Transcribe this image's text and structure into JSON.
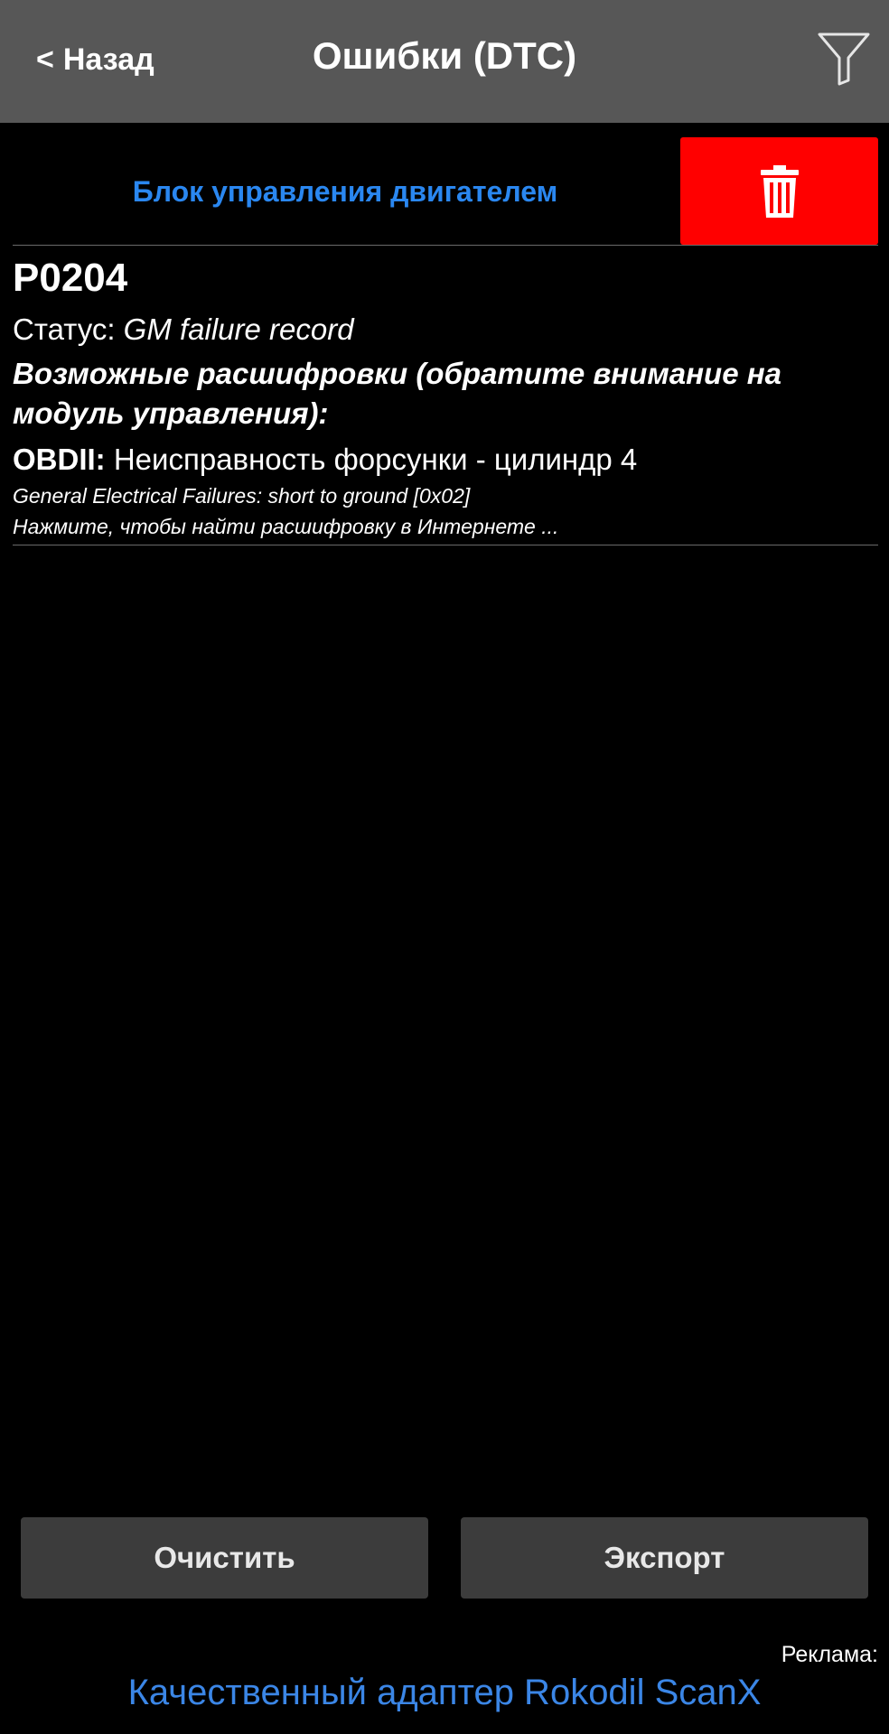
{
  "appbar": {
    "back_label": "Назад",
    "back_chevron": "<",
    "title": "Ошибки (DTC)",
    "filter_icon": "filter-funnel-icon"
  },
  "module": {
    "name": "Блок управления двигателем",
    "delete_icon": "trash-icon",
    "delete_color": "#ff0000",
    "name_color": "#2a87f0"
  },
  "dtc_list": [
    {
      "code": "P0204",
      "status_label": "Статус:",
      "status_value": "GM failure record",
      "hint_title": "Возможные расшифровки (обратите внимание на модуль управления):",
      "standard": "OBDII:",
      "description": "Неисправность форсунки - цилиндр 4",
      "sub_description": "General Electrical Failures: short to ground [0x02]",
      "search_link": "Нажмите, чтобы найти расшифровку в Интернете ..."
    }
  ],
  "buttons": {
    "clear": "Очистить",
    "export": "Экспорт"
  },
  "ad": {
    "label": "Реклама:",
    "link": "Качественный адаптер Rokodil ScanX",
    "link_color": "#3b86e6"
  }
}
